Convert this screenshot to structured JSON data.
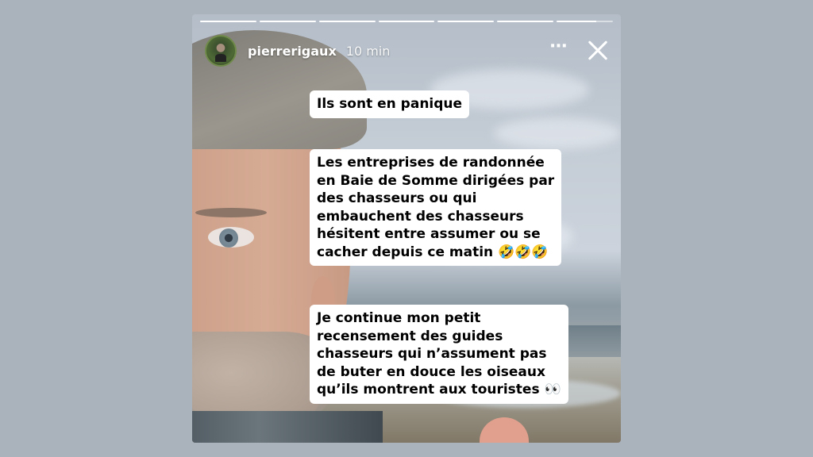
{
  "story": {
    "username": "pierrerigaux",
    "time": "10 min",
    "more_icon": "⋯",
    "progress": [
      1,
      1,
      1,
      1,
      1,
      1,
      0.7
    ],
    "captions": [
      {
        "lines": [
          "Ils sont en panique"
        ]
      },
      {
        "lines": [
          "Les entreprises de randonnée",
          "en Baie de Somme dirigées par",
          "des chasseurs ou qui",
          "embauchent des chasseurs",
          "hésitent entre assumer ou se",
          "cacher depuis ce matin 🤣🤣🤣"
        ]
      },
      {
        "lines": [
          "Je continue mon petit",
          "recensement des guides",
          "chasseurs qui n’assument pas",
          "de buter en douce les oiseaux",
          "qu’ils montrent aux touristes 👀"
        ]
      }
    ]
  }
}
